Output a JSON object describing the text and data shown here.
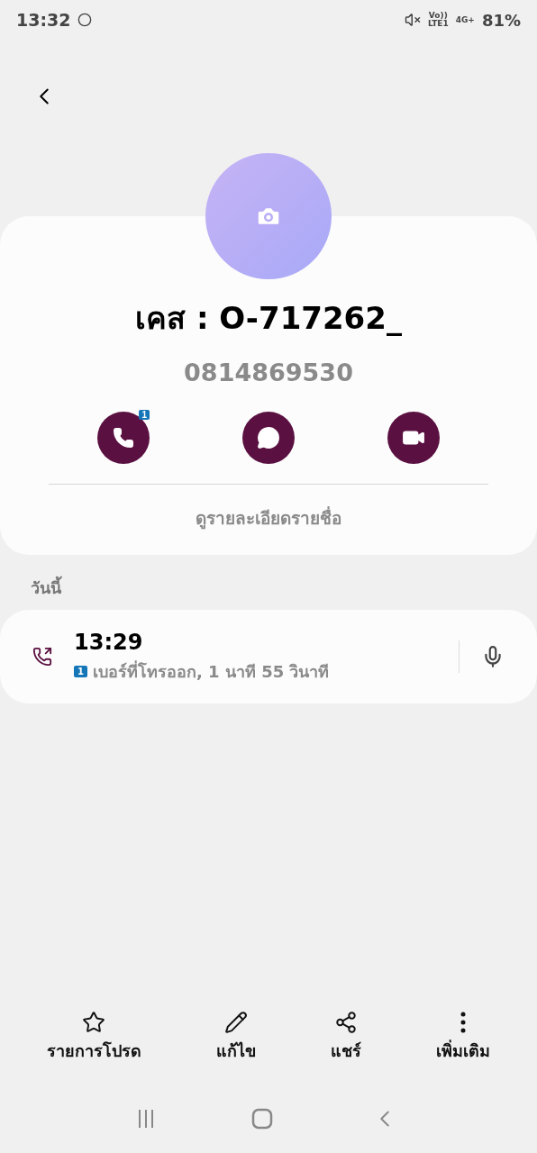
{
  "status_bar": {
    "time": "13:32",
    "battery": "81%",
    "network": "4G+",
    "volte": "Vo))",
    "lte": "LTE1"
  },
  "contact": {
    "name": "เคส : O-717262_",
    "number": "0814869530",
    "call_badge": "1",
    "details_link": "ดูรายละเอียดรายชื่อ"
  },
  "history": {
    "heading": "วันนี้",
    "entries": [
      {
        "time": "13:29",
        "sim": "1",
        "description": "เบอร์ที่โทรออก, 1 นาที 55 วินาที"
      }
    ]
  },
  "bottom_actions": [
    {
      "kind": "star",
      "label": "รายการโปรด"
    },
    {
      "kind": "edit",
      "label": "แก้ไข"
    },
    {
      "kind": "share",
      "label": "แชร์"
    },
    {
      "kind": "more",
      "label": "เพิ่มเติม"
    }
  ]
}
